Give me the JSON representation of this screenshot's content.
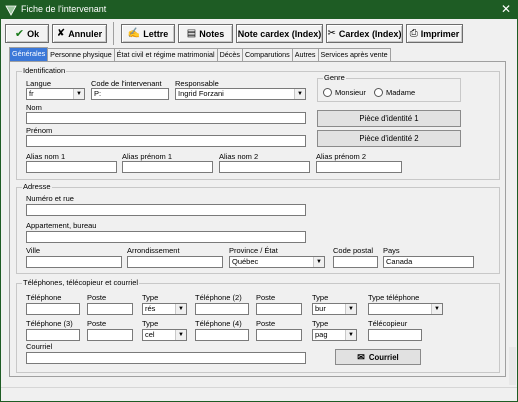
{
  "window": {
    "title": "Fiche de l'intervenant",
    "close_glyph": "✕"
  },
  "toolbar": {
    "ok": "Ok",
    "cancel": "Annuler",
    "letter": "Lettre",
    "notes": "Notes",
    "cardex_note": "Note cardex (Index)",
    "cardex": "Cardex (Index)",
    "print": "Imprimer"
  },
  "tabs": [
    "Générales",
    "Personne physique",
    "État civil et régime matrimonial",
    "Décès",
    "Comparutions",
    "Autres",
    "Services après vente"
  ],
  "identification": {
    "group": "Identification",
    "langue_label": "Langue",
    "langue_value": "fr",
    "code_label": "Code de l'intervenant",
    "code_value": "P:",
    "responsable_label": "Responsable",
    "responsable_value": "Ingrid Forzani",
    "genre_group": "Genre",
    "genre_monsieur": "Monsieur",
    "genre_madame": "Madame",
    "nom_label": "Nom",
    "prenom_label": "Prénom",
    "piece1": "Pièce d'identité 1",
    "piece2": "Pièce d'identité 2",
    "alias_nom1": "Alias nom 1",
    "alias_prenom1": "Alias prénom 1",
    "alias_nom2": "Alias nom 2",
    "alias_prenom2": "Alias prénom 2"
  },
  "adresse": {
    "group": "Adresse",
    "numero_label": "Numéro et rue",
    "appart_label": "Appartement, bureau",
    "ville_label": "Ville",
    "arrond_label": "Arrondissement",
    "province_label": "Province / État",
    "province_value": "Québec",
    "cp_label": "Code postal",
    "pays_label": "Pays",
    "pays_value": "Canada"
  },
  "telephones": {
    "group": "Téléphones, télécopieur et courriel",
    "tel_label": "Téléphone",
    "poste_label": "Poste",
    "type_label": "Type",
    "tel2_label": "Téléphone (2)",
    "type_tel_label": "Type téléphone",
    "tel3_label": "Téléphone (3)",
    "tel4_label": "Téléphone (4)",
    "telecopieur_label": "Télécopieur",
    "courriel_label": "Courriel",
    "type1_value": "rés",
    "type2_value": "bur",
    "type3_value": "cel",
    "type4_value": "pag",
    "courriel_button": "Courriel"
  }
}
